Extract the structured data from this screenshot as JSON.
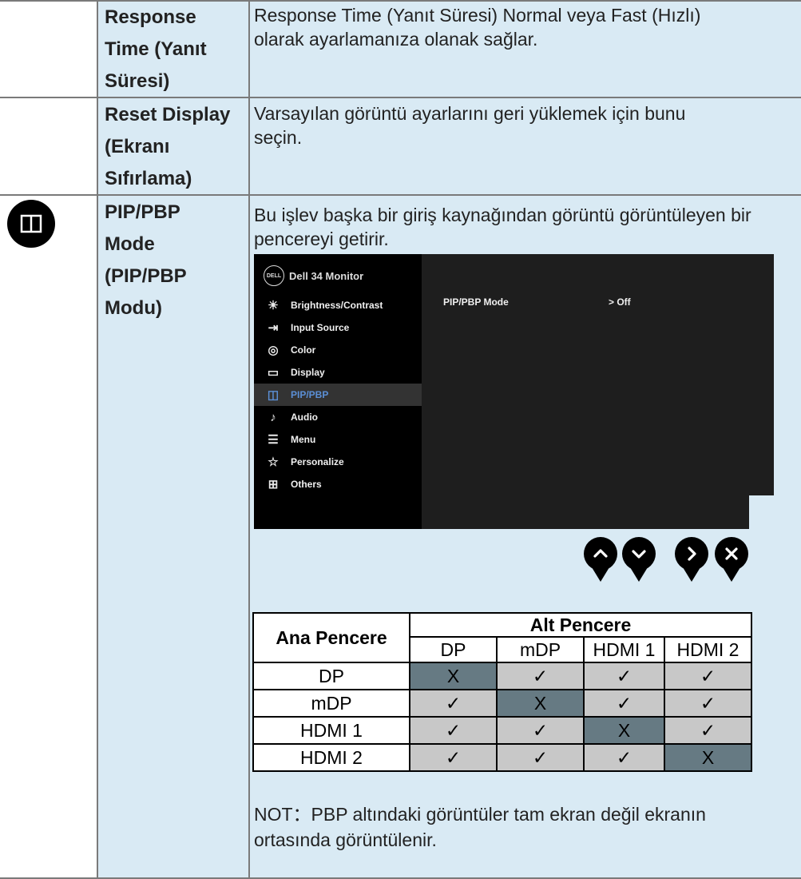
{
  "rows": [
    {
      "label_lines": [
        "Response",
        "Time (Yanıt",
        "Süresi)"
      ],
      "desc_lines": [
        "Response Time (Yanıt Süresi) Normal veya Fast (Hızlı)",
        "olarak ayarlamanıza olanak sağlar."
      ]
    },
    {
      "label_lines": [
        "Reset Display",
        "(Ekranı",
        "Sıfırlama)"
      ],
      "desc_lines": [
        "Varsayılan görüntü ayarlarını geri yüklemek için bunu",
        "seçin."
      ]
    },
    {
      "label_lines": [
        "PIP/PBP",
        "Mode",
        "(PIP/PBP",
        "Modu)"
      ],
      "desc_lines": [
        "Bu işlev başka bir giriş kaynağından görüntü görüntüleyen bir",
        "pencereyi getirir."
      ]
    }
  ],
  "osd": {
    "brand_logo": "DELL",
    "brand_title": "Dell 34 Monitor",
    "menu": [
      {
        "label": "Brightness/Contrast",
        "icon": "brightness-icon"
      },
      {
        "label": "Input Source",
        "icon": "input-source-icon"
      },
      {
        "label": "Color",
        "icon": "color-icon"
      },
      {
        "label": "Display",
        "icon": "display-icon"
      },
      {
        "label": "PIP/PBP",
        "icon": "pip-pbp-icon",
        "selected": true
      },
      {
        "label": "Audio",
        "icon": "audio-icon"
      },
      {
        "label": "Menu",
        "icon": "menu-icon"
      },
      {
        "label": "Personalize",
        "icon": "personalize-icon"
      },
      {
        "label": "Others",
        "icon": "others-icon"
      }
    ],
    "option_label": "PIP/PBP Mode",
    "option_value": "> Off"
  },
  "nav_buttons": [
    "up-button",
    "down-button",
    "right-button",
    "close-button"
  ],
  "table": {
    "main_header": "Ana Pencere",
    "sub_header": "Alt Pencere",
    "columns": [
      "DP",
      "mDP",
      "HDMI 1",
      "HDMI 2"
    ],
    "rows": [
      {
        "name": "DP",
        "cells": [
          "X",
          "✓",
          "✓",
          "✓"
        ]
      },
      {
        "name": "mDP",
        "cells": [
          "✓",
          "X",
          "✓",
          "✓"
        ]
      },
      {
        "name": "HDMI 1",
        "cells": [
          "✓",
          "✓",
          "X",
          "✓"
        ]
      },
      {
        "name": "HDMI 2",
        "cells": [
          "✓",
          "✓",
          "✓",
          "X"
        ]
      }
    ]
  },
  "note": [
    "NOT：PBP altındaki görüntüler tam ekran değil ekranın",
    "ortasında görüntülenir."
  ],
  "colors": {
    "cell_bg": "#d9eaf4",
    "border": "#7a7a7a",
    "x_cell": "#667a83",
    "check_cell": "#c8c8c8",
    "osd_selected": "#5b8fd6"
  }
}
